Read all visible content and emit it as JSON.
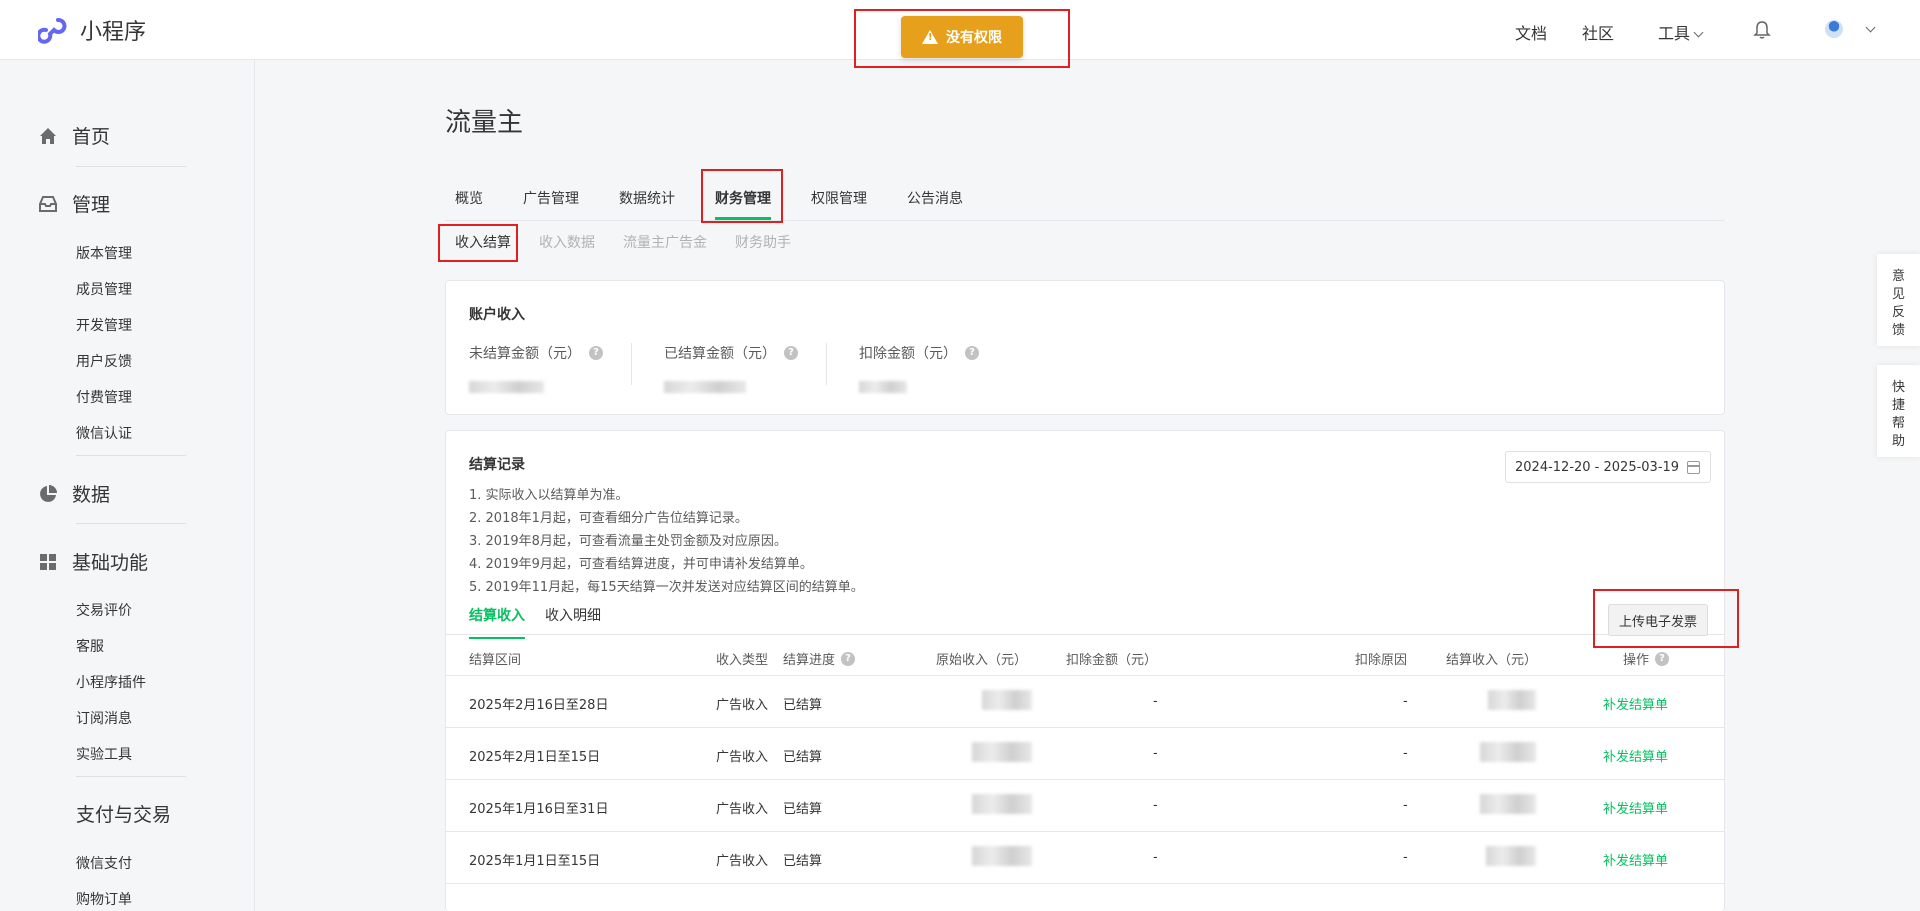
{
  "header": {
    "logo_text": "小程序",
    "nav": [
      "文档",
      "社区",
      "工具"
    ],
    "warning_toast": "没有权限"
  },
  "sidebar": {
    "groups": [
      {
        "label": "首页",
        "icon": "home-icon",
        "items": []
      },
      {
        "label": "管理",
        "icon": "inbox-icon",
        "items": [
          "版本管理",
          "成员管理",
          "开发管理",
          "用户反馈",
          "付费管理",
          "微信认证"
        ]
      },
      {
        "label": "数据",
        "icon": "pie-chart-icon",
        "items": []
      },
      {
        "label": "基础功能",
        "icon": "grid-icon",
        "items": [
          "交易评价",
          "客服",
          "小程序插件",
          "订阅消息",
          "实验工具"
        ]
      },
      {
        "label": "支付与交易",
        "icon": "",
        "items": [
          "微信支付",
          "购物订单"
        ]
      }
    ]
  },
  "main": {
    "title": "流量主",
    "tabs": [
      "概览",
      "广告管理",
      "数据统计",
      "财务管理",
      "权限管理",
      "公告消息"
    ],
    "active_tab": "财务管理",
    "subtabs": [
      "收入结算",
      "收入数据",
      "流量主广告金",
      "财务助手"
    ],
    "active_subtab": "收入结算"
  },
  "account_card": {
    "title": "账户收入",
    "metrics": [
      {
        "label": "未结算金额（元）"
      },
      {
        "label": "已结算金额（元）"
      },
      {
        "label": "扣除金额（元）"
      }
    ]
  },
  "records_card": {
    "title": "结算记录",
    "notes": [
      "1. 实际收入以结算单为准。",
      "2. 2018年1月起，可查看细分广告位结算记录。",
      "3. 2019年8月起，可查看流量主处罚金额及对应原因。",
      "4. 2019年9月起，可查看结算进度，并可申请补发结算单。",
      "5. 2019年11月起，每15天结算一次并发送对应结算区间的结算单。"
    ],
    "date_range": "2024-12-20 - 2025-03-19",
    "inner_tabs": [
      "结算收入",
      "收入明细"
    ],
    "upload_button": "上传电子发票",
    "columns": [
      "结算区间",
      "收入类型",
      "结算进度",
      "原始收入（元）",
      "扣除金额（元）",
      "扣除原因",
      "结算收入（元）",
      "操作"
    ],
    "rows": [
      {
        "period": "2025年2月16日至28日",
        "type": "广告收入",
        "status": "已结算",
        "deduction": "-",
        "reason": "-",
        "action": "补发结算单"
      },
      {
        "period": "2025年2月1日至15日",
        "type": "广告收入",
        "status": "已结算",
        "deduction": "-",
        "reason": "-",
        "action": "补发结算单"
      },
      {
        "period": "2025年1月16日至31日",
        "type": "广告收入",
        "status": "已结算",
        "deduction": "-",
        "reason": "-",
        "action": "补发结算单"
      },
      {
        "period": "2025年1月1日至15日",
        "type": "广告收入",
        "status": "已结算",
        "deduction": "-",
        "reason": "-",
        "action": "补发结算单"
      }
    ]
  },
  "side_float": [
    "意见反馈",
    "快捷帮助"
  ],
  "colors": {
    "accent": "#07c160",
    "warning": "#e6a01b",
    "highlight_box": "#e02020"
  }
}
